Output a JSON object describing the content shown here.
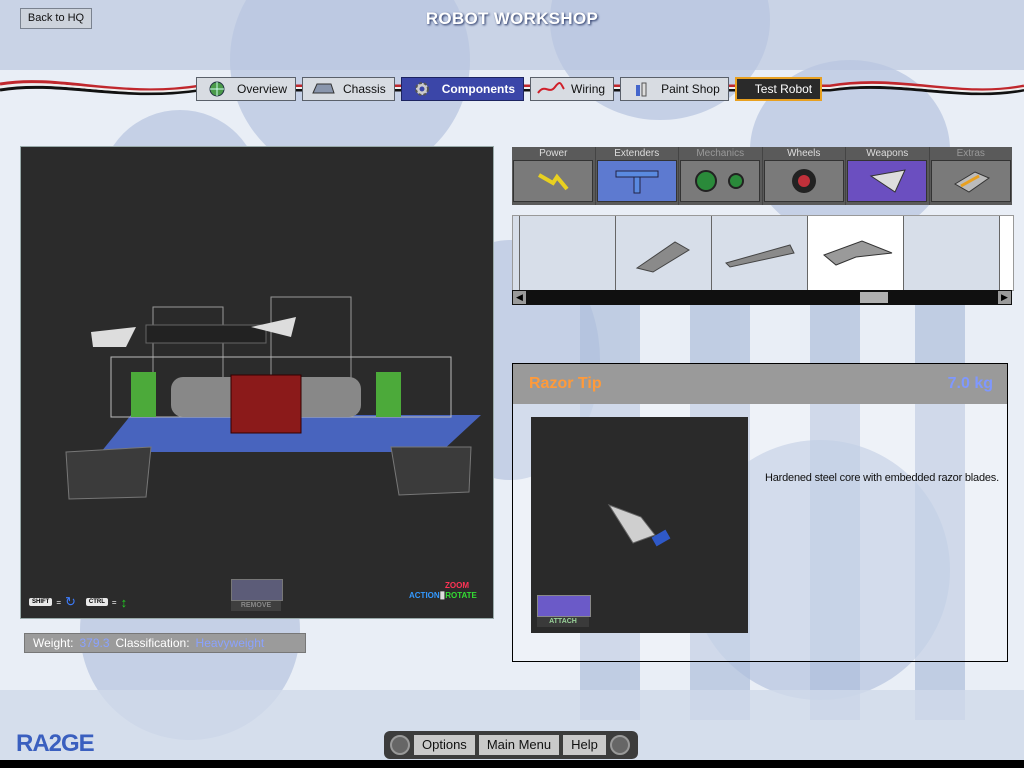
{
  "header": {
    "back_label": "Back to HQ",
    "title": "ROBOT WORKSHOP"
  },
  "nav": {
    "tabs": [
      {
        "label": "Overview",
        "icon": "globe-icon"
      },
      {
        "label": "Chassis",
        "icon": "chassis-icon"
      },
      {
        "label": "Components",
        "icon": "gear-icon",
        "active": true
      },
      {
        "label": "Wiring",
        "icon": "wire-icon"
      },
      {
        "label": "Paint Shop",
        "icon": "paint-icon"
      },
      {
        "label": "Test Robot",
        "icon": "hazard-icon"
      }
    ]
  },
  "viewport": {
    "shift_key": "SHIFT",
    "ctrl_key": "CTRL",
    "eq": "=",
    "remove_label": "REMOVE",
    "zoom_label": "ZOOM",
    "action_label": "ACTION",
    "rotate_label": "ROTATE"
  },
  "status": {
    "weight_label": "Weight:",
    "weight_value": "379.3",
    "class_label": "Classification:",
    "class_value": "Heavyweight"
  },
  "categories": [
    {
      "label": "Power"
    },
    {
      "label": "Extenders"
    },
    {
      "label": "Mechanics"
    },
    {
      "label": "Wheels"
    },
    {
      "label": "Weapons"
    },
    {
      "label": "Extras"
    }
  ],
  "detail": {
    "name": "Razor Tip",
    "weight": "7.0 kg",
    "description": "Hardened steel core with embedded razor blades.",
    "attach_label": "ATTACH"
  },
  "logo": "RA2GE",
  "bottom": {
    "options": "Options",
    "main_menu": "Main Menu",
    "help": "Help"
  },
  "colors": {
    "accent": "#3b46a8",
    "name": "#ff9a3a",
    "weight": "#7f98ff"
  }
}
